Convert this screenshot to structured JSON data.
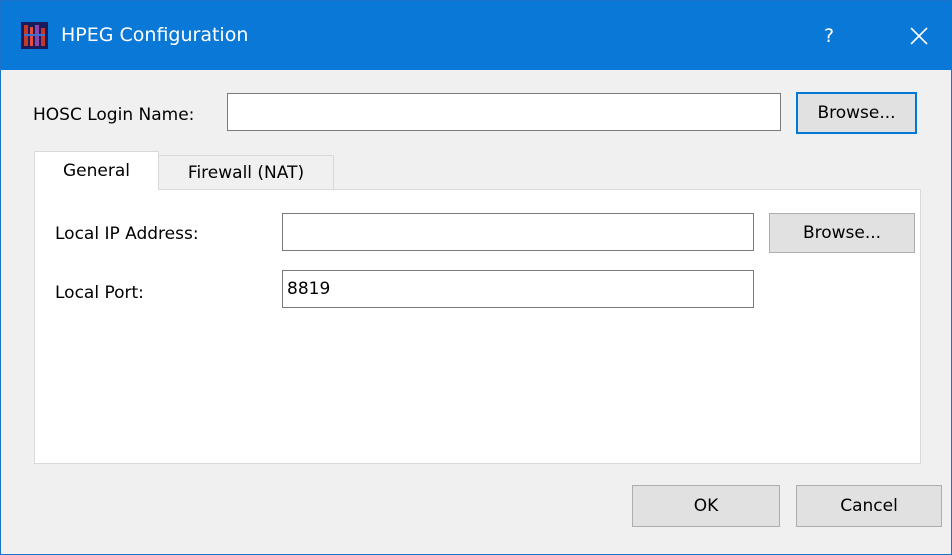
{
  "window": {
    "title": "HPEG Configuration",
    "help_glyph": "?",
    "icons": {
      "app": "app-icon",
      "close": "close-icon"
    },
    "colors": {
      "titlebar": "#0a78d7",
      "default_button_border": "#0078d7"
    }
  },
  "hosc": {
    "label": "HOSC Login Name:",
    "value": "",
    "browse_label": "Browse..."
  },
  "tabs": [
    {
      "label": "General",
      "selected": true
    },
    {
      "label": "Firewall (NAT)",
      "selected": false
    }
  ],
  "general": {
    "local_ip_label": "Local IP Address:",
    "local_ip_value": "",
    "browse_label": "Browse...",
    "local_port_label": "Local Port:",
    "local_port_value": "8819"
  },
  "footer": {
    "ok_label": "OK",
    "cancel_label": "Cancel"
  }
}
